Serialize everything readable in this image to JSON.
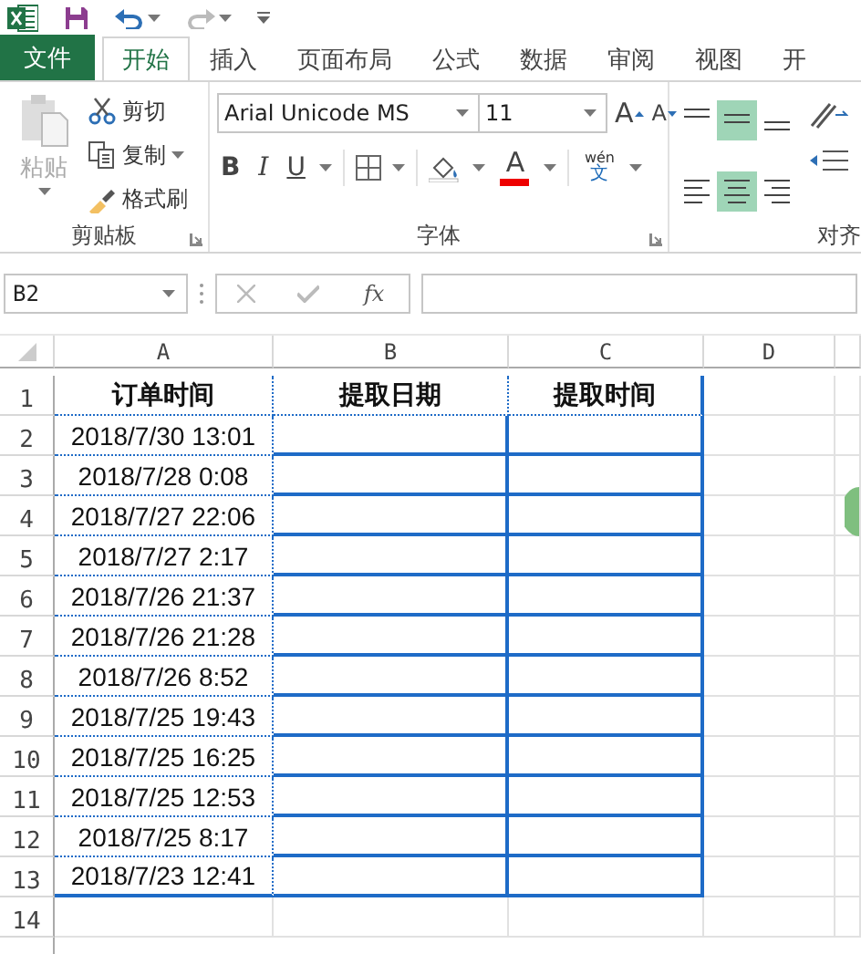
{
  "tabs": [
    {
      "label": "文件",
      "kind": "file",
      "selected": false
    },
    {
      "label": "开始",
      "kind": "tab",
      "selected": true
    },
    {
      "label": "插入",
      "kind": "tab",
      "selected": false
    },
    {
      "label": "页面布局",
      "kind": "tab",
      "selected": false
    },
    {
      "label": "公式",
      "kind": "tab",
      "selected": false
    },
    {
      "label": "数据",
      "kind": "tab",
      "selected": false
    },
    {
      "label": "审阅",
      "kind": "tab",
      "selected": false
    },
    {
      "label": "视图",
      "kind": "tab",
      "selected": false
    },
    {
      "label": "开",
      "kind": "tab",
      "selected": false
    }
  ],
  "clipboard": {
    "paste": "粘贴",
    "paste_disabled": true,
    "cut": "剪切",
    "copy": "复制",
    "format_painter": "格式刷",
    "group_label": "剪贴板"
  },
  "font": {
    "font_name": "Arial Unicode MS",
    "font_size": "11",
    "grow": "A",
    "shrink": "A",
    "bold": "B",
    "italic": "I",
    "underline": "U",
    "font_color": "A",
    "phonetic_top": "wén",
    "phonetic_bottom": "文",
    "group_label": "字体"
  },
  "alignment": {
    "vertical": [
      {
        "selected": false
      },
      {
        "selected": true
      },
      {
        "selected": false
      }
    ],
    "horizontal": [
      {
        "selected": false
      },
      {
        "selected": true
      },
      {
        "selected": false
      }
    ],
    "group_label": "对齐"
  },
  "formula_bar": {
    "name_box": "B2",
    "fx": "fx"
  },
  "sheet": {
    "columns": [
      "A",
      "B",
      "C",
      "D"
    ],
    "rows": [
      {
        "number": "1",
        "cells": [
          "订单时间",
          "提取日期",
          "提取时间"
        ],
        "kind": "header"
      },
      {
        "number": "2",
        "cells": [
          "2018/7/30 13:01",
          "",
          ""
        ],
        "kind": "data"
      },
      {
        "number": "3",
        "cells": [
          "2018/7/28 0:08",
          "",
          ""
        ],
        "kind": "data"
      },
      {
        "number": "4",
        "cells": [
          "2018/7/27 22:06",
          "",
          ""
        ],
        "kind": "data"
      },
      {
        "number": "5",
        "cells": [
          "2018/7/27 2:17",
          "",
          ""
        ],
        "kind": "data"
      },
      {
        "number": "6",
        "cells": [
          "2018/7/26 21:37",
          "",
          ""
        ],
        "kind": "data"
      },
      {
        "number": "7",
        "cells": [
          "2018/7/26 21:28",
          "",
          ""
        ],
        "kind": "data"
      },
      {
        "number": "8",
        "cells": [
          "2018/7/26 8:52",
          "",
          ""
        ],
        "kind": "data"
      },
      {
        "number": "9",
        "cells": [
          "2018/7/25 19:43",
          "",
          ""
        ],
        "kind": "data"
      },
      {
        "number": "10",
        "cells": [
          "2018/7/25 16:25",
          "",
          ""
        ],
        "kind": "data"
      },
      {
        "number": "11",
        "cells": [
          "2018/7/25 12:53",
          "",
          ""
        ],
        "kind": "data"
      },
      {
        "number": "12",
        "cells": [
          "2018/7/25 8:17",
          "",
          ""
        ],
        "kind": "data"
      },
      {
        "number": "13",
        "cells": [
          "2018/7/23 12:41",
          "",
          ""
        ],
        "kind": "data"
      },
      {
        "number": "14",
        "cells": [
          "",
          "",
          ""
        ],
        "kind": "empty"
      }
    ]
  }
}
